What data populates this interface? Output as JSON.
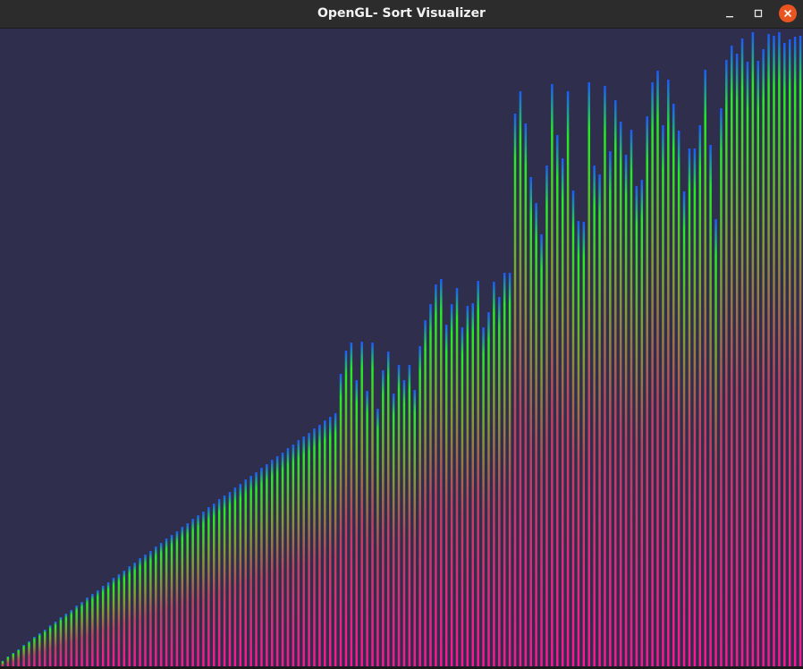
{
  "window": {
    "title": "OpenGL- Sort Visualizer",
    "controls": {
      "minimize_icon": "minimize-icon",
      "maximize_icon": "maximize-icon",
      "close_icon": "close-icon"
    },
    "close_color": "#e95420"
  },
  "colors": {
    "background": "#2f2f4d",
    "titlebar": "#2c2c2c",
    "bar_base": "#ff1493",
    "bar_mid": "#8a7a1f",
    "bar_green": "#22ee22",
    "bar_tip_blue": "#1a5aff"
  },
  "chart_data": {
    "type": "bar",
    "ylim": [
      0,
      716
    ],
    "values": [
      9,
      14,
      18,
      22,
      27,
      31,
      36,
      40,
      44,
      49,
      53,
      58,
      62,
      66,
      71,
      75,
      80,
      84,
      88,
      93,
      97,
      102,
      106,
      110,
      115,
      119,
      124,
      128,
      132,
      137,
      141,
      146,
      150,
      154,
      159,
      163,
      168,
      172,
      176,
      181,
      185,
      190,
      194,
      198,
      203,
      207,
      212,
      216,
      220,
      225,
      229,
      234,
      238,
      242,
      247,
      251,
      256,
      260,
      264,
      269,
      273,
      278,
      282,
      286,
      330,
      356,
      365,
      323,
      366,
      311,
      365,
      291,
      334,
      355,
      308,
      340,
      323,
      340,
      312,
      361,
      390,
      408,
      430,
      436,
      385,
      408,
      426,
      382,
      406,
      409,
      434,
      382,
      399,
      433,
      416,
      443,
      443,
      621,
      646,
      610,
      550,
      521,
      486,
      563,
      654,
      597,
      571,
      646,
      535,
      501,
      500,
      656,
      563,
      553,
      652,
      579,
      636,
      612,
      575,
      603,
      540,
      547,
      618,
      656,
      669,
      608,
      659,
      632,
      602,
      534,
      582,
      582,
      608,
      670,
      586,
      503,
      627,
      681,
      697,
      688,
      705,
      679,
      712,
      680,
      693,
      710,
      708,
      712,
      700,
      704,
      707,
      708
    ]
  }
}
